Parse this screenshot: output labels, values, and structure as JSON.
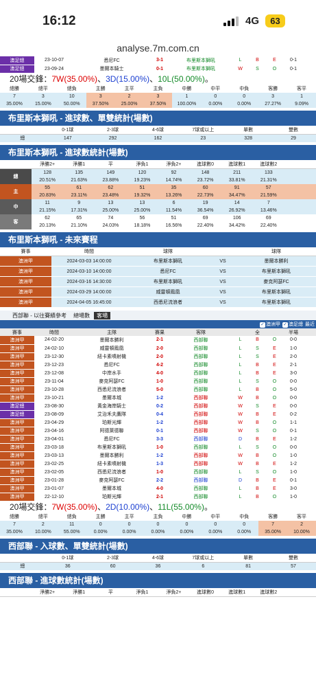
{
  "status": {
    "time": "16:12",
    "network": "4G",
    "battery": "63"
  },
  "url": "analyse.7m.com.cn",
  "top_matches": [
    {
      "league": "澳足總",
      "lg": "lg-b",
      "date": "23-10-07",
      "home": "悉尼FC",
      "score": "3-1",
      "away": "布里斯本獅吼",
      "r": "L",
      "ou": "B",
      "oe": "E",
      "ht": "0-1"
    },
    {
      "league": "澳足總",
      "lg": "lg-b",
      "date": "23-09-24",
      "home": "墨爾本騎士",
      "score": "0-1",
      "away": "布里斯本獅吼",
      "r": "W",
      "ou": "S",
      "oe": "O",
      "ht": "0-1"
    }
  ],
  "summary1": {
    "prefix": "20場交鋒：",
    "w": "7W(35.00%)",
    "d": "3D(15.00%)",
    "l": "10L(50.00%)",
    "sep": "、",
    "end": "。"
  },
  "grid1": {
    "headers": [
      "總勝",
      "總平",
      "總負",
      "主勝",
      "主平",
      "主負",
      "中勝",
      "中平",
      "中負",
      "客勝",
      "客平"
    ],
    "counts": [
      "7",
      "3",
      "10",
      "3",
      "2",
      "3",
      "1",
      "0",
      "0",
      "3",
      "1"
    ],
    "pcts": [
      "35.00%",
      "15.00%",
      "50.00%",
      "37.50%",
      "25.00%",
      "37.50%",
      "100.00%",
      "0.00%",
      "0.00%",
      "27.27%",
      "9.09%"
    ]
  },
  "sec1": {
    "title": "布里斯本獅吼 - 進球數、單雙統計(場數)",
    "headers": [
      "",
      "0-1球",
      "2-3球",
      "4-6球",
      "7球或以上",
      "單數",
      "雙數"
    ],
    "row": [
      "總",
      "147",
      "292",
      "162",
      "23",
      "328",
      "29"
    ]
  },
  "sec2": {
    "title": "布里斯本獅吼 - 進球數統計(場數)",
    "headers": [
      "",
      "淨勝2+",
      "淨勝1",
      "平",
      "淨負1",
      "淨負2+",
      "進球數0",
      "進球數1",
      "進球數2",
      ""
    ],
    "rows": [
      {
        "side": "總",
        "cls": "s1",
        "a": [
          "128",
          "135",
          "149",
          "120",
          "92",
          "148",
          "211",
          "133",
          ""
        ],
        "b": [
          "20.51%",
          "21.63%",
          "23.88%",
          "19.23%",
          "14.74%",
          "23.72%",
          "33.81%",
          "21.31%",
          ""
        ]
      },
      {
        "side": "主",
        "cls": "s2",
        "a": [
          "55",
          "61",
          "62",
          "51",
          "35",
          "60",
          "91",
          "57",
          ""
        ],
        "b": [
          "20.83%",
          "23.11%",
          "23.48%",
          "19.32%",
          "13.26%",
          "22.73%",
          "34.47%",
          "21.59%",
          ""
        ]
      },
      {
        "side": "中",
        "cls": "s3",
        "a": [
          "11",
          "9",
          "13",
          "13",
          "6",
          "19",
          "14",
          "7",
          ""
        ],
        "b": [
          "21.15%",
          "17.31%",
          "25.00%",
          "25.00%",
          "11.54%",
          "36.54%",
          "26.92%",
          "13.46%",
          ""
        ]
      },
      {
        "side": "客",
        "cls": "s4",
        "a": [
          "62",
          "65",
          "74",
          "56",
          "51",
          "69",
          "106",
          "69",
          ""
        ],
        "b": [
          "20.13%",
          "21.10%",
          "24.03%",
          "18.18%",
          "16.56%",
          "22.40%",
          "34.42%",
          "22.40%",
          ""
        ]
      }
    ]
  },
  "sec3": {
    "title": "布里斯本獅吼 - 未來賽程",
    "headers": [
      "賽事",
      "時間",
      "球隊",
      "",
      "球隊"
    ],
    "rows": [
      {
        "lg": "澳洲甲",
        "t": "2024-03-03 14:00:00",
        "h": "布里斯本獅吼",
        "v": "VS",
        "a": "墨爾本勝利"
      },
      {
        "lg": "澳洲甲",
        "t": "2024-03-10 14:00:00",
        "h": "悉尼FC",
        "v": "VS",
        "a": "布里斯本獅吼"
      },
      {
        "lg": "澳洲甲",
        "t": "2024-03-16 14:30:00",
        "h": "布里斯本獅吼",
        "v": "VS",
        "a": "麥克阿瑟FC"
      },
      {
        "lg": "澳洲甲",
        "t": "2024-03-29 14:00:00",
        "h": "威靈頓鳳凰",
        "v": "VS",
        "a": "布里斯本獅吼"
      },
      {
        "lg": "澳洲甲",
        "t": "2024-04-05 16:45:00",
        "h": "西悉尼流浪者",
        "v": "VS",
        "a": "布里斯本獅吼"
      }
    ]
  },
  "tabs": {
    "title": "西部聯 - 以往賽績參考",
    "t1": "總場數",
    "t2": "客場"
  },
  "filter": {
    "f1": "澳洲甲",
    "f2": "澳足總",
    "f3": "最近"
  },
  "hist_headers": [
    "賽事",
    "時間",
    "主隊",
    "賽果",
    "客隊",
    "",
    "全",
    "",
    "半場"
  ],
  "hist": [
    {
      "league": "澳洲甲",
      "lg": "lg-a",
      "date": "24-02-20",
      "home": "墨爾本勝利",
      "score": "2-1",
      "sc": "sc",
      "away": "西部聯",
      "ac": "tg",
      "r": "L",
      "ou": "B",
      "oe": "O",
      "ht": "0-0"
    },
    {
      "league": "澳洲甲",
      "lg": "lg-a",
      "date": "24-02-10",
      "home": "威靈頓鳳凰",
      "score": "2-0",
      "sc": "sc",
      "away": "西部聯",
      "ac": "tg",
      "r": "L",
      "ou": "S",
      "oe": "E",
      "ht": "1-0"
    },
    {
      "league": "澳洲甲",
      "lg": "lg-a",
      "date": "23-12-30",
      "home": "紐卡素噴射機",
      "score": "2-0",
      "sc": "sc",
      "away": "西部聯",
      "ac": "tg",
      "r": "L",
      "ou": "S",
      "oe": "E",
      "ht": "2-0"
    },
    {
      "league": "澳洲甲",
      "lg": "lg-a",
      "date": "23-12-23",
      "home": "悉尼FC",
      "score": "4-2",
      "sc": "sc",
      "away": "西部聯",
      "ac": "tg",
      "r": "L",
      "ou": "B",
      "oe": "E",
      "ht": "2-1"
    },
    {
      "league": "澳洲甲",
      "lg": "lg-a",
      "date": "23-12-08",
      "home": "中岸水手",
      "score": "4-0",
      "sc": "sc",
      "away": "西部聯",
      "ac": "tg",
      "r": "L",
      "ou": "B",
      "oe": "E",
      "ht": "3-0"
    },
    {
      "league": "澳洲甲",
      "lg": "lg-a",
      "date": "23-11-04",
      "home": "麥克阿瑟FC",
      "score": "1-0",
      "sc": "sc",
      "away": "西部聯",
      "ac": "tg",
      "r": "L",
      "ou": "S",
      "oe": "O",
      "ht": "0-0"
    },
    {
      "league": "澳洲甲",
      "lg": "lg-a",
      "date": "23-10-28",
      "home": "西悉尼流浪者",
      "score": "5-0",
      "sc": "sc",
      "away": "西部聯",
      "ac": "tg",
      "r": "L",
      "ou": "B",
      "oe": "O",
      "ht": "5-0"
    },
    {
      "league": "澳洲甲",
      "lg": "lg-a",
      "date": "23-10-21",
      "home": "墨爾本城",
      "score": "1-2",
      "sc": "sc-b",
      "away": "西部聯",
      "ac": "tr",
      "r": "W",
      "ou": "B",
      "oe": "O",
      "ht": "0-0"
    },
    {
      "league": "澳足總",
      "lg": "lg-b",
      "date": "23-08-30",
      "home": "黃金海岸騎士",
      "score": "0-2",
      "sc": "sc-b",
      "away": "西部聯",
      "ac": "tr",
      "r": "W",
      "ou": "S",
      "oe": "E",
      "ht": "0-0"
    },
    {
      "league": "澳足總",
      "lg": "lg-b",
      "date": "23-08-09",
      "home": "艾治禾夫鷹隊",
      "score": "0-4",
      "sc": "sc-b",
      "away": "西部聯",
      "ac": "tr",
      "r": "W",
      "ou": "B",
      "oe": "E",
      "ht": "0-2"
    },
    {
      "league": "澳洲甲",
      "lg": "lg-a",
      "date": "23-04-29",
      "home": "珀斯光輝",
      "score": "1-2",
      "sc": "sc-b",
      "away": "西部聯",
      "ac": "tr",
      "r": "W",
      "ou": "B",
      "oe": "O",
      "ht": "1-1"
    },
    {
      "league": "澳洲甲",
      "lg": "lg-a",
      "date": "23-04-16",
      "home": "阿德萊德聯",
      "score": "0-1",
      "sc": "sc-b",
      "away": "西部聯",
      "ac": "tr",
      "r": "W",
      "ou": "S",
      "oe": "O",
      "ht": "0-1"
    },
    {
      "league": "澳洲甲",
      "lg": "lg-a",
      "date": "23-04-01",
      "home": "悉尼FC",
      "score": "3-3",
      "sc": "sc-b",
      "away": "西部聯",
      "ac": "tb",
      "r": "D",
      "ou": "B",
      "oe": "E",
      "ht": "1-2"
    },
    {
      "league": "澳洲甲",
      "lg": "lg-a",
      "date": "23-03-18",
      "home": "布里斯本獅吼",
      "score": "1-0",
      "sc": "sc",
      "away": "西部聯",
      "ac": "tg",
      "r": "L",
      "ou": "S",
      "oe": "O",
      "ht": "0-0"
    },
    {
      "league": "澳洲甲",
      "lg": "lg-a",
      "date": "23-03-13",
      "home": "墨爾本勝利",
      "score": "1-2",
      "sc": "sc-b",
      "away": "西部聯",
      "ac": "tr",
      "r": "W",
      "ou": "B",
      "oe": "O",
      "ht": "1-0"
    },
    {
      "league": "澳洲甲",
      "lg": "lg-a",
      "date": "23-02-25",
      "home": "紐卡素噴射機",
      "score": "1-3",
      "sc": "sc-b",
      "away": "西部聯",
      "ac": "tr",
      "r": "W",
      "ou": "B",
      "oe": "E",
      "ht": "1-2"
    },
    {
      "league": "澳洲甲",
      "lg": "lg-a",
      "date": "23-02-05",
      "home": "西悉尼流浪者",
      "score": "1-0",
      "sc": "sc",
      "away": "西部聯",
      "ac": "tg",
      "r": "L",
      "ou": "S",
      "oe": "O",
      "ht": "1-0"
    },
    {
      "league": "澳洲甲",
      "lg": "lg-a",
      "date": "23-01-28",
      "home": "麥克阿瑟FC",
      "score": "2-2",
      "sc": "sc-b",
      "away": "西部聯",
      "ac": "tb",
      "r": "D",
      "ou": "B",
      "oe": "E",
      "ht": "0-1"
    },
    {
      "league": "澳洲甲",
      "lg": "lg-a",
      "date": "23-01-07",
      "home": "墨爾本城",
      "score": "4-0",
      "sc": "sc",
      "away": "西部聯",
      "ac": "tg",
      "r": "L",
      "ou": "B",
      "oe": "E",
      "ht": "3-0"
    },
    {
      "league": "澳洲甲",
      "lg": "lg-a",
      "date": "22-12-10",
      "home": "珀斯光輝",
      "score": "2-1",
      "sc": "sc",
      "away": "西部聯",
      "ac": "tg",
      "r": "L",
      "ou": "B",
      "oe": "O",
      "ht": "1-0"
    }
  ],
  "summary2": {
    "prefix": "20場交鋒：",
    "w": "7W(35.00%)",
    "d": "2D(10.00%)",
    "l": "11L(55.00%)",
    "sep": "、",
    "end": "。"
  },
  "grid2": {
    "headers": [
      "總勝",
      "總平",
      "總負",
      "主勝",
      "主平",
      "主負",
      "中勝",
      "中平",
      "中負",
      "客勝",
      "客平"
    ],
    "counts": [
      "7",
      "2",
      "11",
      "0",
      "0",
      "0",
      "0",
      "0",
      "0",
      "7",
      "2"
    ],
    "pcts": [
      "35.00%",
      "10.00%",
      "55.00%",
      "0.00%",
      "0.00%",
      "0.00%",
      "0.00%",
      "0.00%",
      "0.00%",
      "35.00%",
      "10.00%"
    ]
  },
  "sec4": {
    "title": "西部聯 - 入球數、單雙統計(場數)",
    "headers": [
      "",
      "0-1球",
      "2-3球",
      "4-6球",
      "7球或以上",
      "單數",
      "雙數"
    ],
    "row": [
      "總",
      "36",
      "60",
      "36",
      "6",
      "81",
      "57"
    ]
  },
  "sec5": {
    "title": "西部聯 - 進球數統計(場數)",
    "headers": [
      "",
      "淨勝2+",
      "淨勝1",
      "平",
      "淨負1",
      "淨負2+",
      "進球數0",
      "進球數1",
      "進球數2",
      ""
    ]
  }
}
